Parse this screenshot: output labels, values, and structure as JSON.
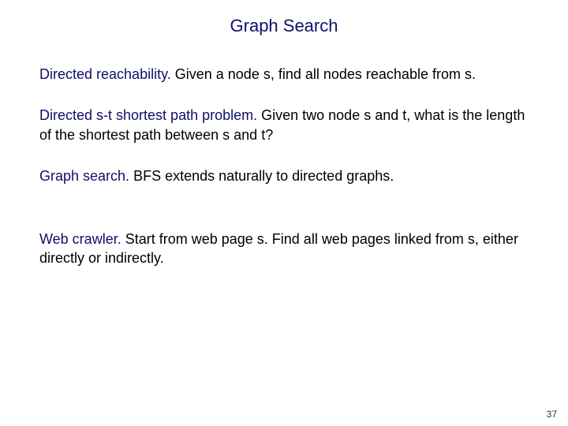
{
  "title": "Graph Search",
  "paragraphs": [
    {
      "lead": "Directed reachability.",
      "rest": "  Given a node s, find all nodes reachable from s."
    },
    {
      "lead": "Directed s-t shortest path problem.",
      "rest": "  Given two node s and t, what is the length of the shortest path between s and t?"
    },
    {
      "lead": "Graph search.",
      "rest": "  BFS extends naturally to directed graphs."
    },
    {
      "lead": "Web crawler.",
      "rest": "  Start from web page s.  Find all web pages linked from s, either directly or indirectly."
    }
  ],
  "page_number": "37",
  "spacer_after_index": 2
}
